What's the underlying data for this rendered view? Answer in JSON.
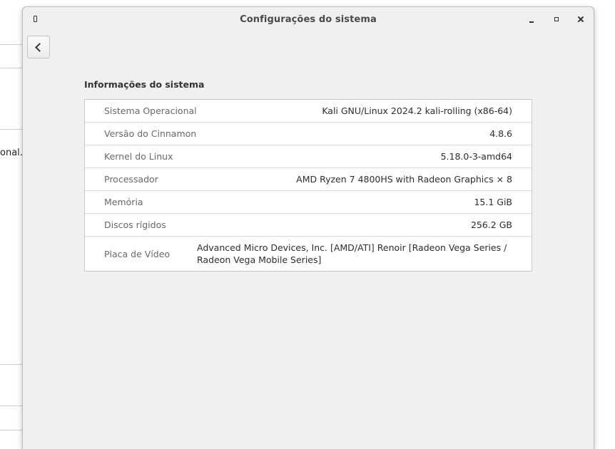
{
  "background": {
    "partial_text": "onal. "
  },
  "window": {
    "title": "Configurações do sistema"
  },
  "section": {
    "title": "Informações do sistema"
  },
  "info": [
    {
      "label": "Sistema Operacional",
      "value": "Kali GNU/Linux 2024.2 kali-rolling (x86-64)"
    },
    {
      "label": "Versão do Cinnamon",
      "value": "4.8.6"
    },
    {
      "label": "Kernel do Linux",
      "value": "5.18.0-3-amd64"
    },
    {
      "label": "Processador",
      "value": "AMD Ryzen 7 4800HS with Radeon Graphics × 8"
    },
    {
      "label": "Memória",
      "value": "15.1 GiB"
    },
    {
      "label": "Discos rígidos",
      "value": "256.2 GB"
    },
    {
      "label": "Placa de Vídeo",
      "value": "Advanced Micro Devices, Inc. [AMD/ATI] Renoir [Radeon Vega Series / Radeon Vega Mobile Series]"
    }
  ],
  "icons": {
    "back": "chevron-left-icon",
    "minimize": "minimize-icon",
    "maximize": "maximize-icon",
    "close": "close-icon",
    "window_menu": "pin-icon"
  }
}
